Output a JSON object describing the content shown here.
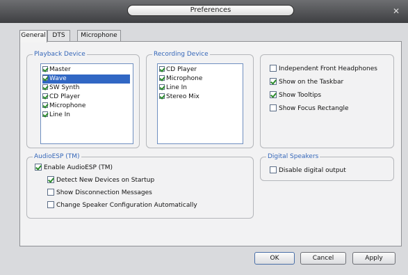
{
  "window": {
    "title": "Preferences",
    "close_glyph": "✕"
  },
  "tabs": [
    {
      "label": "General"
    },
    {
      "label": "DTS"
    },
    {
      "label": "Microphone"
    }
  ],
  "playback": {
    "title": "Playback Device",
    "items": [
      {
        "label": "Master",
        "checked": true
      },
      {
        "label": "Wave",
        "checked": true,
        "selected": true
      },
      {
        "label": "SW Synth",
        "checked": true
      },
      {
        "label": "CD Player",
        "checked": true
      },
      {
        "label": "Microphone",
        "checked": true
      },
      {
        "label": "Line In",
        "checked": true
      }
    ]
  },
  "recording": {
    "title": "Recording Device",
    "items": [
      {
        "label": "CD Player",
        "checked": true
      },
      {
        "label": "Microphone",
        "checked": true
      },
      {
        "label": "Line In",
        "checked": true
      },
      {
        "label": "Stereo Mix",
        "checked": true
      }
    ]
  },
  "options": {
    "independent_front_headphones": {
      "label": "Independent Front Headphones",
      "checked": false
    },
    "show_on_taskbar": {
      "label": "Show on the Taskbar",
      "checked": true
    },
    "show_tooltips": {
      "label": "Show Tooltips",
      "checked": true
    },
    "show_focus_rectangle": {
      "label": "Show Focus Rectangle",
      "checked": false
    }
  },
  "audioesp": {
    "title": "AudioESP (TM)",
    "enable": {
      "label": "Enable AudioESP (TM)",
      "checked": true
    },
    "detect_new": {
      "label": "Detect New Devices on Startup",
      "checked": true
    },
    "show_disconnection": {
      "label": "Show Disconnection Messages",
      "checked": false
    },
    "change_config": {
      "label": "Change Speaker Configuration Automatically",
      "checked": false
    }
  },
  "digital": {
    "title": "Digital Speakers",
    "disable_output": {
      "label": "Disable digital output",
      "checked": false
    }
  },
  "buttons": {
    "ok": "OK",
    "cancel": "Cancel",
    "apply": "Apply"
  }
}
